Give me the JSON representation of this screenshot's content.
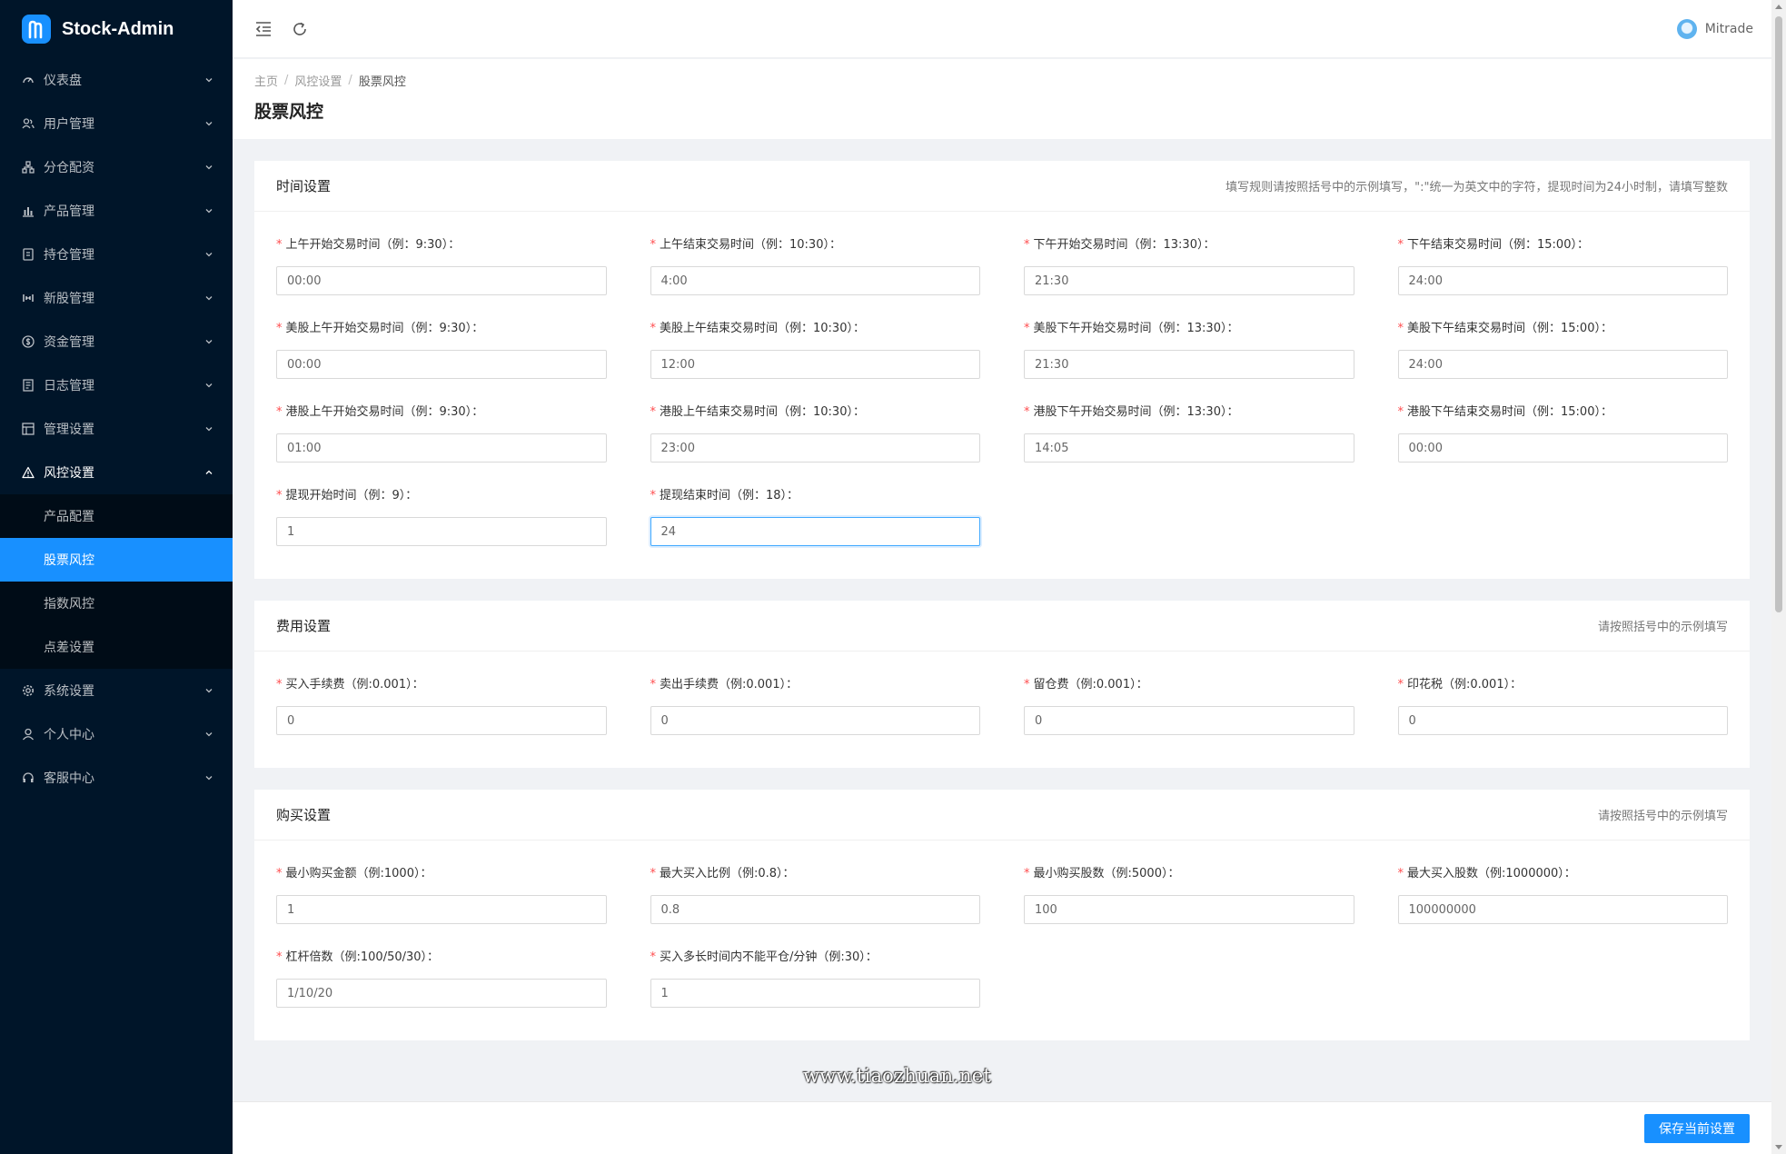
{
  "app": {
    "title": "Stock-Admin"
  },
  "header": {
    "username": "Mitrade"
  },
  "sidebar": {
    "items": [
      {
        "label": "仪表盘",
        "icon": "dashboard-icon"
      },
      {
        "label": "用户管理",
        "icon": "user-group-icon"
      },
      {
        "label": "分仓配资",
        "icon": "cluster-icon"
      },
      {
        "label": "产品管理",
        "icon": "bar-chart-icon"
      },
      {
        "label": "持仓管理",
        "icon": "file-icon"
      },
      {
        "label": "新股管理",
        "icon": "stock-icon"
      },
      {
        "label": "资金管理",
        "icon": "dollar-icon"
      },
      {
        "label": "日志管理",
        "icon": "log-icon"
      },
      {
        "label": "管理设置",
        "icon": "table-icon"
      },
      {
        "label": "风控设置",
        "icon": "warning-icon"
      },
      {
        "label": "系统设置",
        "icon": "gear-icon"
      },
      {
        "label": "个人中心",
        "icon": "user-icon"
      },
      {
        "label": "客服中心",
        "icon": "headset-icon"
      }
    ],
    "submenu": [
      "产品配置",
      "股票风控",
      "指数风控",
      "点差设置"
    ]
  },
  "breadcrumb": [
    "主页",
    "风控设置",
    "股票风控"
  ],
  "page_title": "股票风控",
  "sections": [
    {
      "title": "时间设置",
      "hint": "填写规则请按照括号中的示例填写，\":\"统一为英文中的字符，提现时间为24小时制，请填写整数",
      "fields": [
        {
          "label": "上午开始交易时间（例：9:30）：",
          "value": "00:00"
        },
        {
          "label": "上午结束交易时间（例：10:30）：",
          "value": "4:00"
        },
        {
          "label": "下午开始交易时间（例：13:30）：",
          "value": "21:30"
        },
        {
          "label": "下午结束交易时间（例：15:00）：",
          "value": "24:00"
        },
        {
          "label": "美股上午开始交易时间（例：9:30）：",
          "value": "00:00"
        },
        {
          "label": "美股上午结束交易时间（例：10:30）：",
          "value": "12:00"
        },
        {
          "label": "美股下午开始交易时间（例：13:30）：",
          "value": "21:30"
        },
        {
          "label": "美股下午结束交易时间（例：15:00）：",
          "value": "24:00"
        },
        {
          "label": "港股上午开始交易时间（例：9:30）：",
          "value": "01:00"
        },
        {
          "label": "港股上午结束交易时间（例：10:30）：",
          "value": "23:00"
        },
        {
          "label": "港股下午开始交易时间（例：13:30）：",
          "value": "14:05"
        },
        {
          "label": "港股下午结束交易时间（例：15:00）：",
          "value": "00:00"
        },
        {
          "label": "提现开始时间（例：9）：",
          "value": "1"
        },
        {
          "label": "提现结束时间（例：18）：",
          "value": "24"
        }
      ]
    },
    {
      "title": "费用设置",
      "hint": "请按照括号中的示例填写",
      "fields": [
        {
          "label": "买入手续费（例:0.001）：",
          "value": "0"
        },
        {
          "label": "卖出手续费（例:0.001）：",
          "value": "0"
        },
        {
          "label": "留仓费（例:0.001）：",
          "value": "0"
        },
        {
          "label": "印花税（例:0.001）：",
          "value": "0"
        }
      ]
    },
    {
      "title": "购买设置",
      "hint": "请按照括号中的示例填写",
      "fields": [
        {
          "label": "最小购买金额（例:1000）：",
          "value": "1"
        },
        {
          "label": "最大买入比例（例:0.8）：",
          "value": "0.8"
        },
        {
          "label": "最小购买股数（例:5000）：",
          "value": "100"
        },
        {
          "label": "最大买入股数（例:1000000）：",
          "value": "100000000"
        },
        {
          "label": "杠杆倍数（例:100/50/30）：",
          "value": "1/10/20"
        },
        {
          "label": "买入多长时间内不能平仓/分钟（例:30）：",
          "value": "1"
        }
      ]
    }
  ],
  "footer": {
    "save_label": "保存当前设置"
  },
  "watermark": "www.tiaozhuan.net",
  "colors": {
    "sidebar_bg": "#001529",
    "accent": "#1890ff",
    "required": "#ff4d4f"
  }
}
